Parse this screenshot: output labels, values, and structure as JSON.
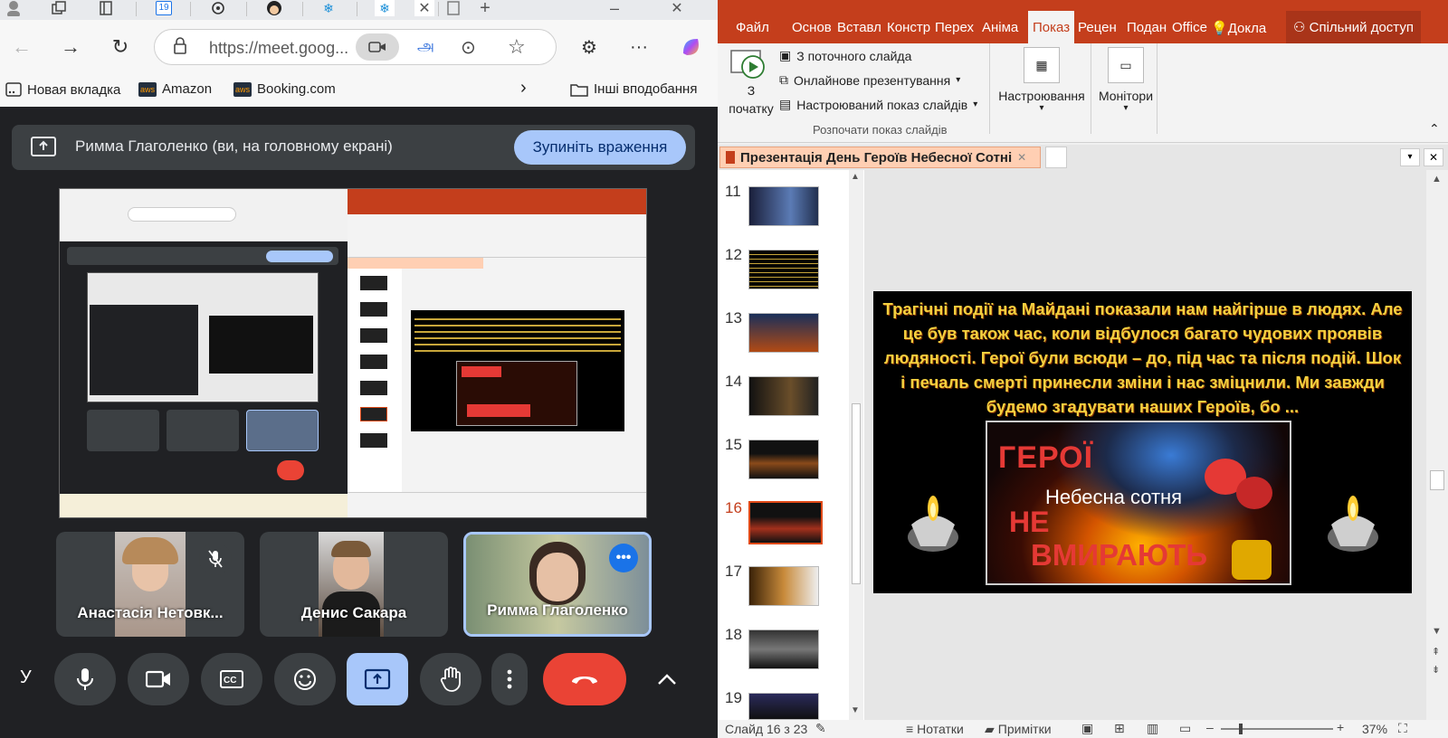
{
  "browser": {
    "address_url": "https://meet.goog...",
    "calendar_tab_number": "19",
    "bookmarks": {
      "new_tab": "Новая вкладка",
      "amazon": "Amazon",
      "booking": "Booking.com",
      "other": "Інші вподобання",
      "aws_badge": "aws"
    }
  },
  "meet": {
    "share_banner": "Римма Глаголенко (ви, на головному екрані)",
    "stop_sharing": "Зупиніть враження",
    "participants": [
      {
        "name": "Анастасія Нетовк..."
      },
      {
        "name": "Денис Сакара"
      },
      {
        "name": "Римма Глаголенко"
      }
    ],
    "letter": "У"
  },
  "ppt": {
    "ribbon_tabs": [
      "Файл",
      "Основ",
      "Вставл",
      "Констр",
      "Перех",
      "Аніма",
      "Показ",
      "Рецен",
      "Подан",
      "Office",
      "Докла",
      "Спільний доступ"
    ],
    "active_tab": "Показ",
    "from_start_1": "З",
    "from_start_2": "початку",
    "from_current": "З поточного слайда",
    "online": "Онлайнове презентування",
    "custom": "Настроюваний показ слайдів",
    "group_label": "Розпочати показ слайдів",
    "settings": "Настроювання",
    "monitors": "Монітори",
    "document_tab": "Презентація День Героїв Небесної Сотні",
    "thumbnails": [
      "11",
      "12",
      "13",
      "14",
      "15",
      "16",
      "17",
      "18",
      "19"
    ],
    "selected_slide": "16",
    "slide": {
      "text": "Трагічні події на Майдані показали нам найгірше в людях. Але це був також час, коли відбулося багато чудових проявів людяності. Герої були всюди – до, під час та після подій. Шок і печаль смерті принесли зміни і нас зміцнили. Ми завжди будемо згадувати наших Героїв, бо ...",
      "heroes": "ГЕРОЇ",
      "sky_hundred": "Небесна сотня",
      "not": "НЕ",
      "die": "ВМИРАЮТЬ"
    },
    "status": {
      "slide_info": "Слайд 16 з 23",
      "notes": "Нотатки",
      "comments": "Примітки",
      "zoom": "37%"
    }
  },
  "colors": {
    "ppt_accent": "#c43e1c",
    "meet_bg": "#202124",
    "stop_button": "#a8c7fa",
    "end_call": "#ea4335",
    "slide_text": "#f4d03f"
  }
}
